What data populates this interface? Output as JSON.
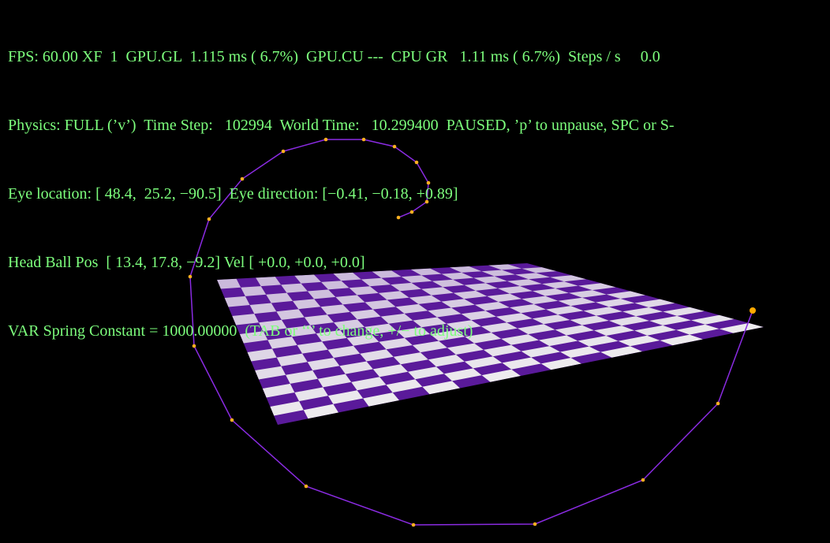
{
  "hud": {
    "text_color": "#7dff7d",
    "line1": "FPS: 60.00 XF  1  GPU.GL  1.115 ms ( 6.7%)  GPU.CU ---  CPU GR   1.11 ms ( 6.7%)  Steps / s     0.0",
    "line2": "Physics: FULL (’v’)  Time Step:   102994  World Time:   10.299400  PAUSED, ’p’ to unpause, SPC or S-",
    "line3": "Eye location: [ 48.4,  25.2, −90.5]  Eye direction: [−0.41, −0.18, +0.89]",
    "line4": "Head Ball Pos  [ 13.4, 17.8, −9.2] Vel [ +0.0, +0.0, +0.0]",
    "line5": "VAR Spring Constant = 1000.00000  (TAB or ‘‘’ to change, +/− to adjust)"
  },
  "scene": {
    "background": "#000000",
    "platform_colors": {
      "purple": "#5a1a9a",
      "white": "#f0f0f0"
    },
    "spring_color": "#8a2be2",
    "ball_color": "#ffb020",
    "head_ball_color": "#ffaa00"
  }
}
